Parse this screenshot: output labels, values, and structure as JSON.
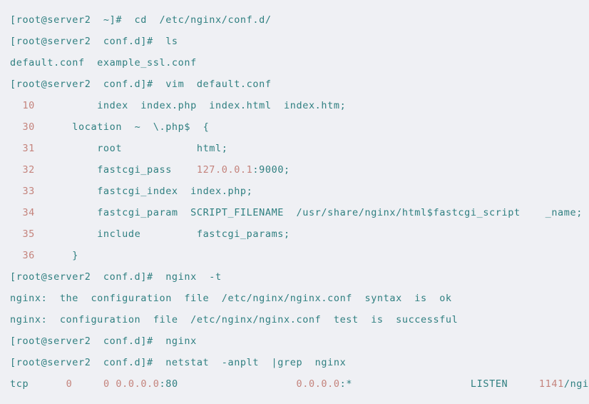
{
  "terminal": {
    "background_color": "#eff0f4",
    "text_color": "#2f7f80",
    "accent_color": "#c4837c",
    "font_size_px": 13.5,
    "line_height_px": 30,
    "hostname": "server2",
    "user": "root",
    "lines": [
      {
        "id": "cmd-cd",
        "type": "command",
        "segments": [
          {
            "text": "[root@server2  ~]#  cd  /etc/nginx/conf.d/",
            "color": "teal"
          }
        ]
      },
      {
        "id": "cmd-ls",
        "type": "command",
        "segments": [
          {
            "text": "[root@server2  conf.d]#  ls",
            "color": "teal"
          }
        ]
      },
      {
        "id": "out-ls",
        "type": "output",
        "segments": [
          {
            "text": "default.conf  example_ssl.conf",
            "color": "teal"
          }
        ]
      },
      {
        "id": "cmd-vim",
        "type": "command",
        "segments": [
          {
            "text": "[root@server2  conf.d]#  vim  default.conf",
            "color": "teal"
          }
        ]
      },
      {
        "id": "conf-10",
        "type": "config",
        "segments": [
          {
            "text": "  10",
            "color": "salmon"
          },
          {
            "text": "          index  index.php  index.html  index.htm;",
            "color": "teal"
          }
        ]
      },
      {
        "id": "conf-30",
        "type": "config",
        "segments": [
          {
            "text": "  30",
            "color": "salmon"
          },
          {
            "text": "      location  ~  \\.php$  {",
            "color": "teal"
          }
        ]
      },
      {
        "id": "conf-31",
        "type": "config",
        "segments": [
          {
            "text": "  31",
            "color": "salmon"
          },
          {
            "text": "          root            html;",
            "color": "teal"
          }
        ]
      },
      {
        "id": "conf-32",
        "type": "config",
        "segments": [
          {
            "text": "  32",
            "color": "salmon"
          },
          {
            "text": "          fastcgi_pass    ",
            "color": "teal"
          },
          {
            "text": "127.0.0.1",
            "color": "salmon"
          },
          {
            "text": ":9000;",
            "color": "teal"
          }
        ]
      },
      {
        "id": "conf-33",
        "type": "config",
        "segments": [
          {
            "text": "  33",
            "color": "salmon"
          },
          {
            "text": "          fastcgi_index  index.php;",
            "color": "teal"
          }
        ]
      },
      {
        "id": "conf-34",
        "type": "config",
        "segments": [
          {
            "text": "  34",
            "color": "salmon"
          },
          {
            "text": "          fastcgi_param  SCRIPT_FILENAME  /usr/share/nginx/html$fastcgi_script    _name;",
            "color": "teal"
          }
        ]
      },
      {
        "id": "conf-35",
        "type": "config",
        "segments": [
          {
            "text": "  35",
            "color": "salmon"
          },
          {
            "text": "          include         fastcgi_params;",
            "color": "teal"
          }
        ]
      },
      {
        "id": "conf-36",
        "type": "config",
        "segments": [
          {
            "text": "  36",
            "color": "salmon"
          },
          {
            "text": "      }",
            "color": "teal"
          }
        ]
      },
      {
        "id": "cmd-nginx-t",
        "type": "command",
        "segments": [
          {
            "text": "[root@server2  conf.d]#  nginx  -t",
            "color": "teal"
          }
        ]
      },
      {
        "id": "out-nginx-syntax",
        "type": "output",
        "segments": [
          {
            "text": "nginx:  the  configuration  file  /etc/nginx/nginx.conf  syntax  is  ok",
            "color": "teal"
          }
        ]
      },
      {
        "id": "out-nginx-test",
        "type": "output",
        "segments": [
          {
            "text": "nginx:  configuration  file  /etc/nginx/nginx.conf  test  is  successful",
            "color": "teal"
          }
        ]
      },
      {
        "id": "cmd-nginx-start",
        "type": "command",
        "segments": [
          {
            "text": "[root@server2  conf.d]#  nginx",
            "color": "teal"
          }
        ]
      },
      {
        "id": "cmd-netstat",
        "type": "command",
        "segments": [
          {
            "text": "[root@server2  conf.d]#  netstat  -anplt  |grep  nginx",
            "color": "teal"
          }
        ]
      },
      {
        "id": "out-netstat-tcp",
        "type": "output",
        "segments": [
          {
            "text": "tcp      ",
            "color": "teal"
          },
          {
            "text": "0",
            "color": "salmon"
          },
          {
            "text": "     ",
            "color": "teal"
          },
          {
            "text": "0",
            "color": "salmon"
          },
          {
            "text": " ",
            "color": "teal"
          },
          {
            "text": "0.0.0.0",
            "color": "salmon"
          },
          {
            "text": ":80",
            "color": "teal"
          },
          {
            "text": "                   ",
            "color": "teal"
          },
          {
            "text": "0.0.0.0",
            "color": "salmon"
          },
          {
            "text": ":*",
            "color": "teal"
          },
          {
            "text": "                   ",
            "color": "teal"
          },
          {
            "text": "LISTEN",
            "color": "teal"
          },
          {
            "text": "     ",
            "color": "teal"
          },
          {
            "text": "1141",
            "color": "salmon"
          },
          {
            "text": "/nginx",
            "color": "teal"
          }
        ]
      }
    ]
  }
}
